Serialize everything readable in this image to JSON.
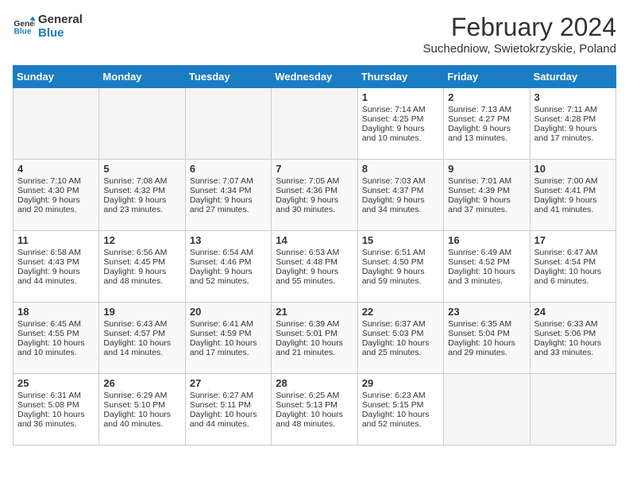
{
  "header": {
    "logo_line1": "General",
    "logo_line2": "Blue",
    "month_year": "February 2024",
    "location": "Suchedniow, Swietokrzyskie, Poland"
  },
  "days_of_week": [
    "Sunday",
    "Monday",
    "Tuesday",
    "Wednesday",
    "Thursday",
    "Friday",
    "Saturday"
  ],
  "weeks": [
    [
      {
        "day": "",
        "empty": true
      },
      {
        "day": "",
        "empty": true
      },
      {
        "day": "",
        "empty": true
      },
      {
        "day": "",
        "empty": true
      },
      {
        "day": "1",
        "sunrise": "Sunrise: 7:14 AM",
        "sunset": "Sunset: 4:25 PM",
        "daylight": "Daylight: 9 hours and 10 minutes."
      },
      {
        "day": "2",
        "sunrise": "Sunrise: 7:13 AM",
        "sunset": "Sunset: 4:27 PM",
        "daylight": "Daylight: 9 hours and 13 minutes."
      },
      {
        "day": "3",
        "sunrise": "Sunrise: 7:11 AM",
        "sunset": "Sunset: 4:28 PM",
        "daylight": "Daylight: 9 hours and 17 minutes."
      }
    ],
    [
      {
        "day": "4",
        "sunrise": "Sunrise: 7:10 AM",
        "sunset": "Sunset: 4:30 PM",
        "daylight": "Daylight: 9 hours and 20 minutes."
      },
      {
        "day": "5",
        "sunrise": "Sunrise: 7:08 AM",
        "sunset": "Sunset: 4:32 PM",
        "daylight": "Daylight: 9 hours and 23 minutes."
      },
      {
        "day": "6",
        "sunrise": "Sunrise: 7:07 AM",
        "sunset": "Sunset: 4:34 PM",
        "daylight": "Daylight: 9 hours and 27 minutes."
      },
      {
        "day": "7",
        "sunrise": "Sunrise: 7:05 AM",
        "sunset": "Sunset: 4:36 PM",
        "daylight": "Daylight: 9 hours and 30 minutes."
      },
      {
        "day": "8",
        "sunrise": "Sunrise: 7:03 AM",
        "sunset": "Sunset: 4:37 PM",
        "daylight": "Daylight: 9 hours and 34 minutes."
      },
      {
        "day": "9",
        "sunrise": "Sunrise: 7:01 AM",
        "sunset": "Sunset: 4:39 PM",
        "daylight": "Daylight: 9 hours and 37 minutes."
      },
      {
        "day": "10",
        "sunrise": "Sunrise: 7:00 AM",
        "sunset": "Sunset: 4:41 PM",
        "daylight": "Daylight: 9 hours and 41 minutes."
      }
    ],
    [
      {
        "day": "11",
        "sunrise": "Sunrise: 6:58 AM",
        "sunset": "Sunset: 4:43 PM",
        "daylight": "Daylight: 9 hours and 44 minutes."
      },
      {
        "day": "12",
        "sunrise": "Sunrise: 6:56 AM",
        "sunset": "Sunset: 4:45 PM",
        "daylight": "Daylight: 9 hours and 48 minutes."
      },
      {
        "day": "13",
        "sunrise": "Sunrise: 6:54 AM",
        "sunset": "Sunset: 4:46 PM",
        "daylight": "Daylight: 9 hours and 52 minutes."
      },
      {
        "day": "14",
        "sunrise": "Sunrise: 6:53 AM",
        "sunset": "Sunset: 4:48 PM",
        "daylight": "Daylight: 9 hours and 55 minutes."
      },
      {
        "day": "15",
        "sunrise": "Sunrise: 6:51 AM",
        "sunset": "Sunset: 4:50 PM",
        "daylight": "Daylight: 9 hours and 59 minutes."
      },
      {
        "day": "16",
        "sunrise": "Sunrise: 6:49 AM",
        "sunset": "Sunset: 4:52 PM",
        "daylight": "Daylight: 10 hours and 3 minutes."
      },
      {
        "day": "17",
        "sunrise": "Sunrise: 6:47 AM",
        "sunset": "Sunset: 4:54 PM",
        "daylight": "Daylight: 10 hours and 6 minutes."
      }
    ],
    [
      {
        "day": "18",
        "sunrise": "Sunrise: 6:45 AM",
        "sunset": "Sunset: 4:55 PM",
        "daylight": "Daylight: 10 hours and 10 minutes."
      },
      {
        "day": "19",
        "sunrise": "Sunrise: 6:43 AM",
        "sunset": "Sunset: 4:57 PM",
        "daylight": "Daylight: 10 hours and 14 minutes."
      },
      {
        "day": "20",
        "sunrise": "Sunrise: 6:41 AM",
        "sunset": "Sunset: 4:59 PM",
        "daylight": "Daylight: 10 hours and 17 minutes."
      },
      {
        "day": "21",
        "sunrise": "Sunrise: 6:39 AM",
        "sunset": "Sunset: 5:01 PM",
        "daylight": "Daylight: 10 hours and 21 minutes."
      },
      {
        "day": "22",
        "sunrise": "Sunrise: 6:37 AM",
        "sunset": "Sunset: 5:03 PM",
        "daylight": "Daylight: 10 hours and 25 minutes."
      },
      {
        "day": "23",
        "sunrise": "Sunrise: 6:35 AM",
        "sunset": "Sunset: 5:04 PM",
        "daylight": "Daylight: 10 hours and 29 minutes."
      },
      {
        "day": "24",
        "sunrise": "Sunrise: 6:33 AM",
        "sunset": "Sunset: 5:06 PM",
        "daylight": "Daylight: 10 hours and 33 minutes."
      }
    ],
    [
      {
        "day": "25",
        "sunrise": "Sunrise: 6:31 AM",
        "sunset": "Sunset: 5:08 PM",
        "daylight": "Daylight: 10 hours and 36 minutes."
      },
      {
        "day": "26",
        "sunrise": "Sunrise: 6:29 AM",
        "sunset": "Sunset: 5:10 PM",
        "daylight": "Daylight: 10 hours and 40 minutes."
      },
      {
        "day": "27",
        "sunrise": "Sunrise: 6:27 AM",
        "sunset": "Sunset: 5:11 PM",
        "daylight": "Daylight: 10 hours and 44 minutes."
      },
      {
        "day": "28",
        "sunrise": "Sunrise: 6:25 AM",
        "sunset": "Sunset: 5:13 PM",
        "daylight": "Daylight: 10 hours and 48 minutes."
      },
      {
        "day": "29",
        "sunrise": "Sunrise: 6:23 AM",
        "sunset": "Sunset: 5:15 PM",
        "daylight": "Daylight: 10 hours and 52 minutes."
      },
      {
        "day": "",
        "empty": true
      },
      {
        "day": "",
        "empty": true
      }
    ]
  ]
}
